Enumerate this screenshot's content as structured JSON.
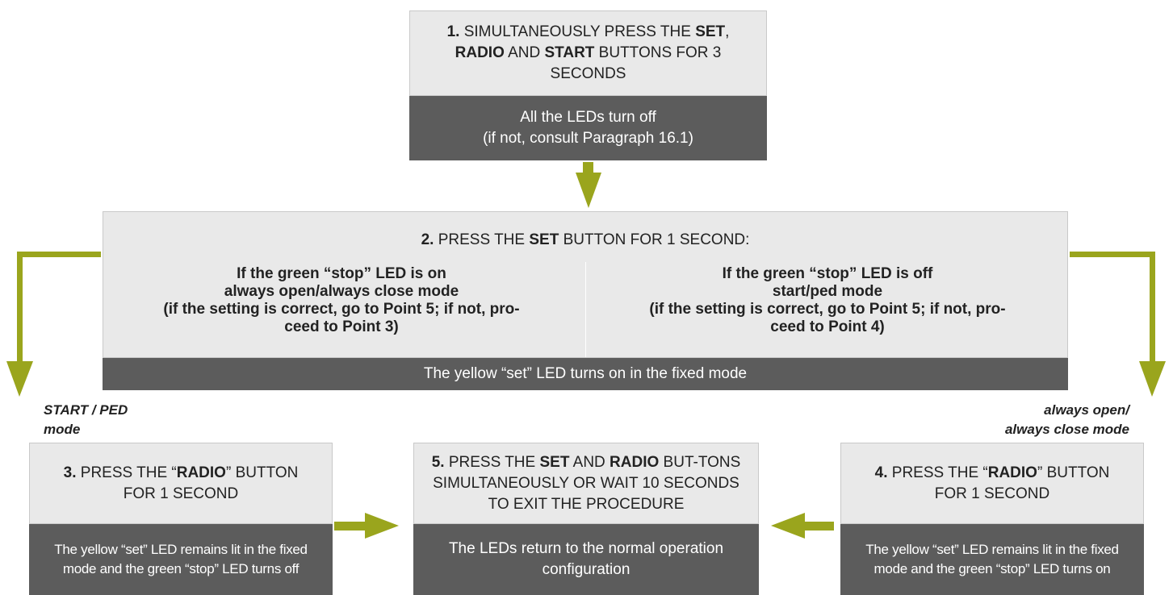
{
  "step1": {
    "n": "1.",
    "t1": " SIMULTANEOUSLY PRESS THE ",
    "b1": "SET",
    "t2": ", ",
    "b2": "RADIO",
    "t3": " AND ",
    "b3": "START",
    "t4": " BUTTONS FOR 3 SECONDS",
    "result_line1": "All the LEDs turn off",
    "result_line2": "(if not, consult Paragraph 16.1)"
  },
  "step2": {
    "n": "2.",
    "t1": " PRESS THE ",
    "b1": "SET",
    "t2": " BUTTON FOR 1 SECOND:",
    "left": {
      "line1": "If the green “stop” LED is on",
      "line2": "always open/always close mode",
      "line3": "(if the setting is correct, go to Point 5; if not, pro-",
      "line4": "ceed to Point 3)"
    },
    "right": {
      "line1": "If the green “stop” LED is off",
      "line2": "start/ped mode",
      "line3": "(if the setting is correct, go to Point 5; if not, pro-",
      "line4": "ceed to Point 4)"
    },
    "result": "The yellow “set” LED turns on in the fixed mode"
  },
  "label_left": {
    "line1": "START / PED",
    "line2": "mode"
  },
  "label_right": {
    "line1": "always open/",
    "line2": "always close mode"
  },
  "step3": {
    "n": "3.",
    "t1": " PRESS THE “",
    "b1": "RADIO",
    "t2": "” BUTTON FOR 1 SECOND",
    "result_line1": "The yellow “set” LED remains lit in the fixed",
    "result_line2": "mode and the green “stop” LED turns off"
  },
  "step4": {
    "n": "4.",
    "t1": " PRESS THE “",
    "b1": "RADIO",
    "t2": "” BUTTON FOR 1 SECOND",
    "result_line1": "The yellow “set” LED remains lit in the fixed",
    "result_line2": "mode and the green “stop” LED turns on"
  },
  "step5": {
    "n": "5.",
    "t1": " PRESS THE ",
    "b1": "SET",
    "t2": " AND ",
    "b2": "RADIO",
    "t3": " BUT-TONS SIMULTANEOUSLY OR WAIT 10 SECONDS TO EXIT THE PROCEDURE",
    "result_line1": "The LEDs return to the normal operation",
    "result_line2": "configuration"
  },
  "colors": {
    "arrow": "#9aa51d",
    "box_light": "#e9e9e9",
    "box_dark": "#5c5c5c"
  }
}
